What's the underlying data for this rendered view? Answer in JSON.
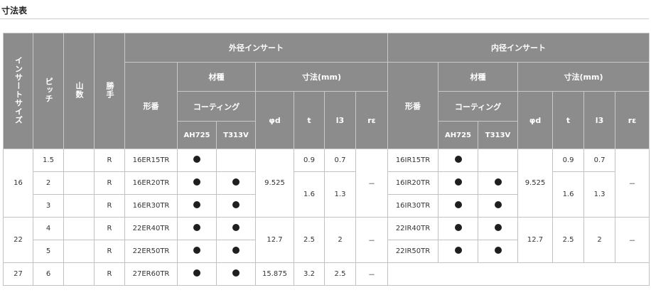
{
  "title": "寸法表",
  "headers": {
    "insert_size": "インサートサイズ",
    "pitch": "ピッチ",
    "threads": "山数",
    "hand": "勝手",
    "external": "外径インサート",
    "internal": "内径インサート",
    "part_no": "形番",
    "material": "材種",
    "coating": "コーティング",
    "grade_1": "AH725",
    "grade_2": "T313V",
    "dimensions": "寸法(mm)",
    "phi_d": "φd",
    "t": "t",
    "l3": "l3",
    "r_eps": "rε"
  },
  "groups": [
    {
      "size": "16",
      "ext_phi_d": "9.525",
      "ext_r": "－",
      "int_phi_d": "9.525",
      "int_r": "－",
      "rows": [
        {
          "pitch": "1.5",
          "hand": "R",
          "ext_part": "16ER15TR",
          "ext_ah725": true,
          "ext_t313v": false,
          "int_part": "16IR15TR",
          "int_ah725": true,
          "int_t313v": false
        },
        {
          "pitch": "2",
          "hand": "R",
          "ext_part": "16ER20TR",
          "ext_ah725": true,
          "ext_t313v": true,
          "int_part": "16IR20TR",
          "int_ah725": true,
          "int_t313v": true
        },
        {
          "pitch": "3",
          "hand": "R",
          "ext_part": "16ER30TR",
          "ext_ah725": true,
          "ext_t313v": true,
          "int_part": "16IR30TR",
          "int_ah725": true,
          "int_t313v": true
        }
      ],
      "ext_t1": "0.9",
      "ext_l1": "0.7",
      "ext_t2": "1.6",
      "ext_l2": "1.3",
      "int_t1": "0.9",
      "int_l1": "0.7",
      "int_t2": "1.6",
      "int_l2": "1.3"
    },
    {
      "size": "22",
      "ext_phi_d": "12.7",
      "ext_t": "2.5",
      "ext_l": "2",
      "ext_r": "－",
      "int_phi_d": "12.7",
      "int_t": "2.5",
      "int_l": "2",
      "int_r": "－",
      "rows": [
        {
          "pitch": "4",
          "hand": "R",
          "ext_part": "22ER40TR",
          "ext_ah725": true,
          "ext_t313v": true,
          "int_part": "22IR40TR",
          "int_ah725": true,
          "int_t313v": true
        },
        {
          "pitch": "5",
          "hand": "R",
          "ext_part": "22ER50TR",
          "ext_ah725": true,
          "ext_t313v": true,
          "int_part": "22IR50TR",
          "int_ah725": true,
          "int_t313v": true
        }
      ]
    },
    {
      "size": "27",
      "rows": [
        {
          "pitch": "6",
          "hand": "R",
          "ext_part": "27ER60TR",
          "ext_ah725": true,
          "ext_t313v": true,
          "ext_phi_d": "15.875",
          "ext_t": "3.2",
          "ext_l": "2.5",
          "ext_r": "－"
        }
      ]
    }
  ]
}
